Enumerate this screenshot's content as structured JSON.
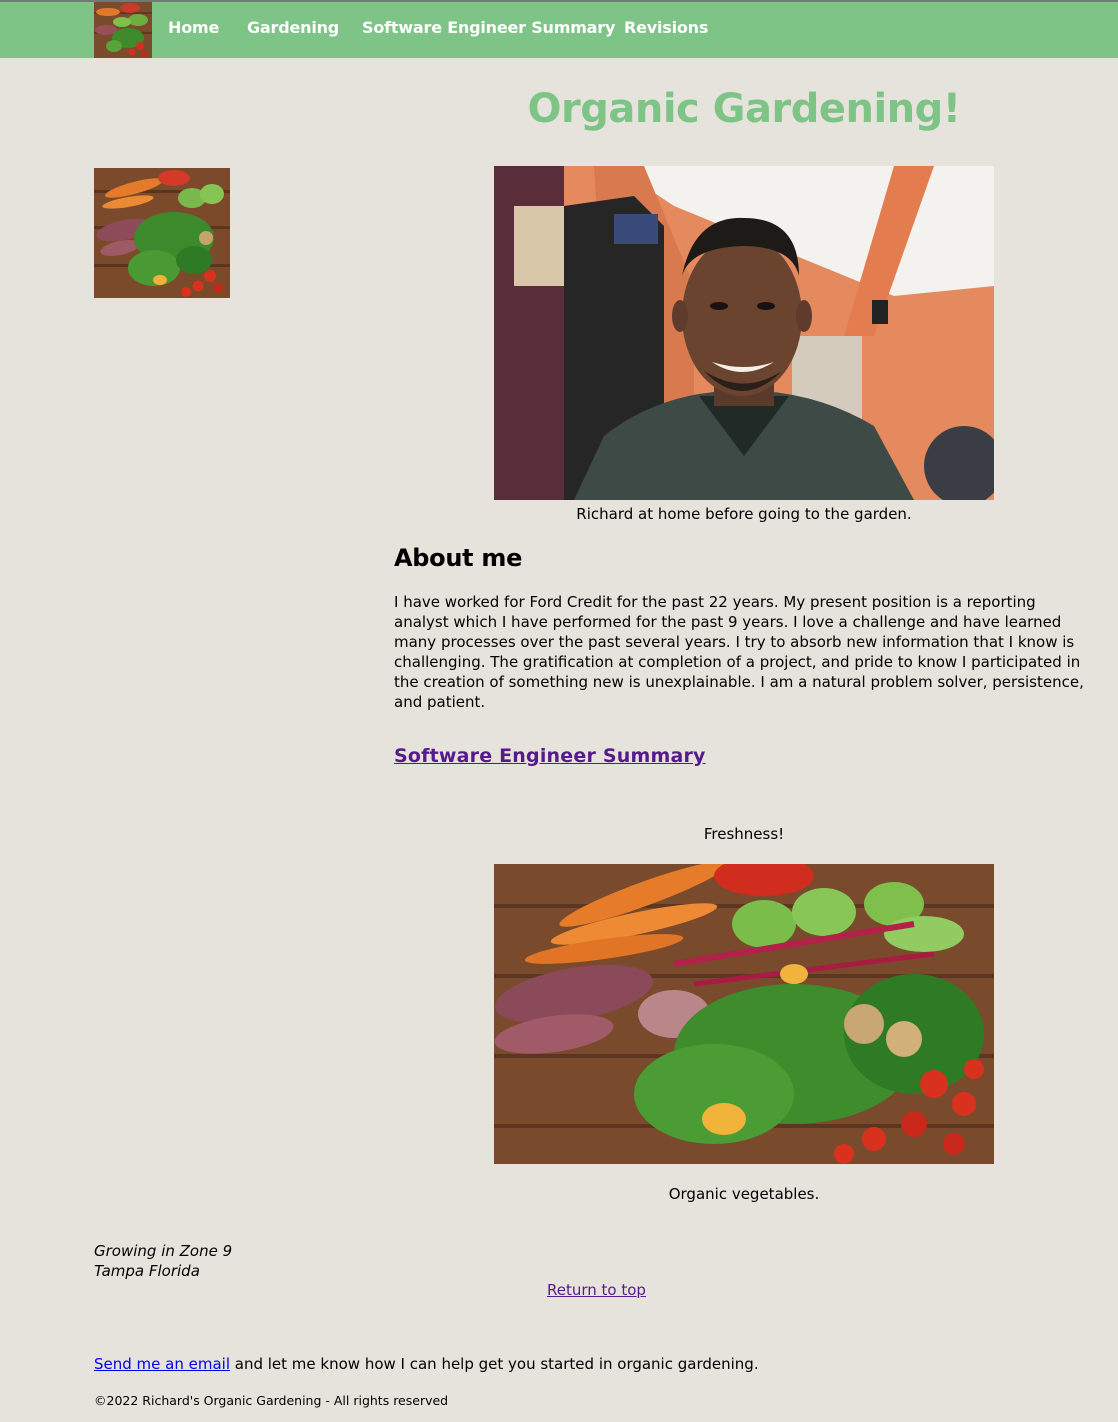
{
  "nav": {
    "items": [
      {
        "label": "Home"
      },
      {
        "label": "Gardening"
      },
      {
        "label": "Software Engineer Summary"
      },
      {
        "label": "Revisions"
      }
    ]
  },
  "header": {
    "title": "Organic Gardening!"
  },
  "images": {
    "portrait_caption": "Richard at home before going to the garden.",
    "freshness_label": "Freshness!",
    "vegetables_caption": "Organic vegetables."
  },
  "about": {
    "heading": "About me",
    "text": "I have worked for Ford Credit for the past 22 years. My present position is a reporting analyst which I have performed for the past 9 years. I love a challenge and have learned many processes over the past several years. I try to absorb new information that I know is challenging. The gratification at completion of a project, and pride to know I participated in the creation of something new is unexplainable. I am a natural problem solver, persistence, and patient."
  },
  "summary_link": "Software Engineer Summary",
  "location": {
    "line1": "Growing in Zone 9",
    "line2": "Tampa Florida"
  },
  "return_to_top": "Return to top",
  "footer": {
    "email_link": "Send me an email",
    "email_text": " and let me know how I can help get you started in organic gardening.",
    "copyright": "©2022 Richard's Organic Gardening - All rights reserved"
  },
  "colors": {
    "nav_background": "#7fc487",
    "page_background": "#e6e3dc",
    "title": "#7fc487",
    "visited_link": "#551a8b",
    "link": "#0000ee"
  }
}
